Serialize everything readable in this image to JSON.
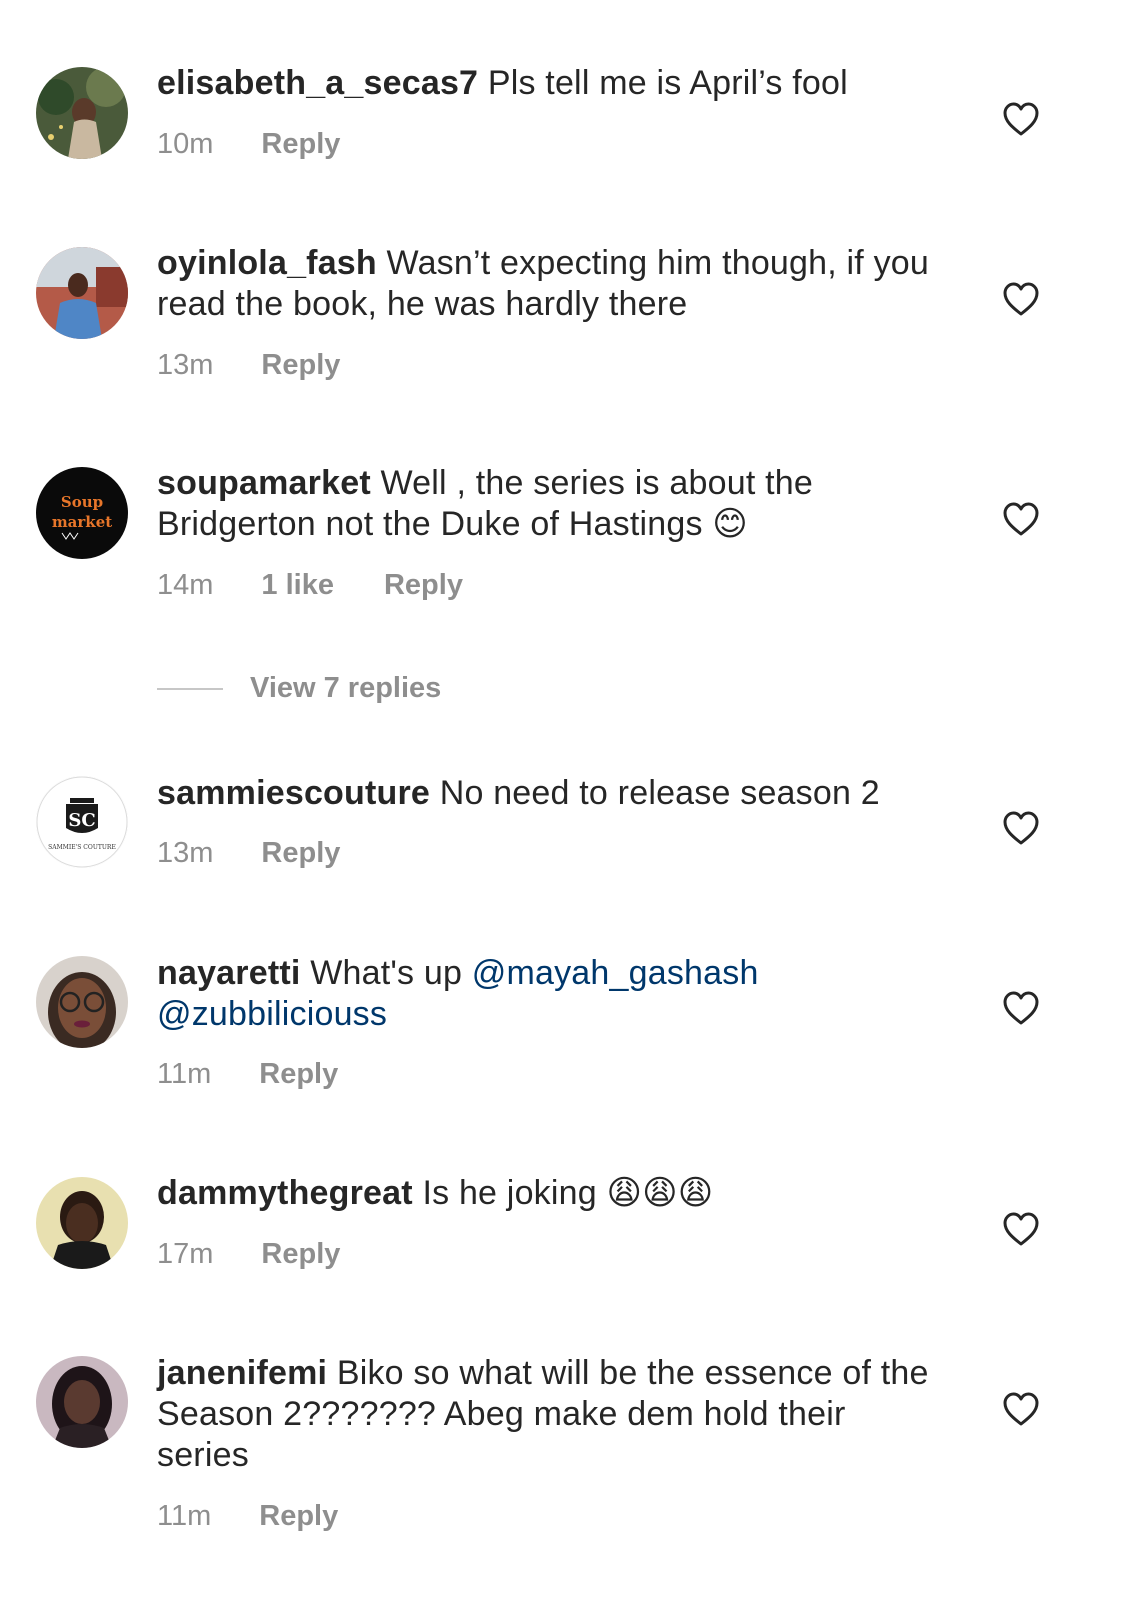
{
  "comments": [
    {
      "username": "elisabeth_a_secas7",
      "text": "Pls tell me is April’s fool",
      "time": "10m",
      "reply": "Reply",
      "avatar": "avatar-elisabeth"
    },
    {
      "username": "oyinlola_fash",
      "text": "Wasn’t expecting him though, if you read the book, he was hardly there",
      "time": "13m",
      "reply": "Reply",
      "avatar": "avatar-oyinlola"
    },
    {
      "username": "soupamarket",
      "text": "Well , the series is about the Bridgerton not the Duke of Hastings",
      "emoji": "😊",
      "time": "14m",
      "likes": "1 like",
      "reply": "Reply",
      "avatar": "avatar-soupamarket",
      "logo_text": "Soup A market"
    },
    {
      "username": "sammiescouture",
      "text": "No need to release season 2",
      "time": "13m",
      "reply": "Reply",
      "avatar": "avatar-sammiescouture",
      "logo_text": "SAMMIE'S COUTURE"
    },
    {
      "username": "nayaretti",
      "text": "What's up",
      "mention1": "@mayah_gashash",
      "mention2": "@zubbiliciouss",
      "time": "11m",
      "reply": "Reply",
      "avatar": "avatar-nayaretti"
    },
    {
      "username": "dammythegreat",
      "text": "Is he joking",
      "emoji": "😩😩😩",
      "time": "17m",
      "reply": "Reply",
      "avatar": "avatar-dammythegreat"
    },
    {
      "username": "janenifemi",
      "text": "Biko so what will be the essence of the Season 2??????? Abeg make dem hold their series",
      "time": "11m",
      "reply": "Reply",
      "avatar": "avatar-janenifemi"
    }
  ],
  "view_replies": "View 7 replies",
  "icons": {
    "like": "heart-outline-icon"
  },
  "colors": {
    "text": "#262626",
    "meta": "#8e8e8e",
    "mention": "#00376b"
  }
}
